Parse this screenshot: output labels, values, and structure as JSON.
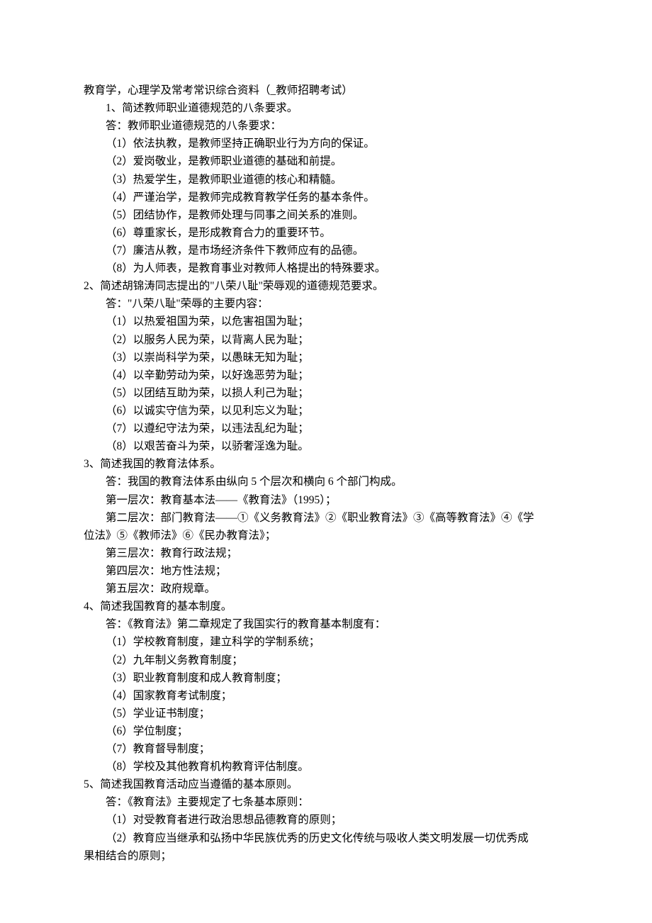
{
  "title": "教育学，心理学及常考常识综合资料（_教师招聘考试）",
  "sections": [
    {
      "q": "1、简述教师职业道德规范的八条要求。",
      "ans": "答：教师职业道德规范的八条要求：",
      "items": [
        "（1）依法执教，是教师坚持正确职业行为方向的保证。",
        "（2）爱岗敬业，是教师职业道德的基础和前提。",
        "（3）热爱学生，是教师职业道德的核心和精髓。",
        "（4）严谨治学，是教师完成教育教学任务的基本条件。",
        "（5）团结协作，是教师处理与同事之间关系的准则。",
        "（6）尊重家长，是形成教育合力的重要环节。",
        "（7）廉洁从教，是市场经济条件下教师应有的品德。",
        "（8）为人师表，是教育事业对教师人格提出的特殊要求。"
      ],
      "q_indent": true
    },
    {
      "q": "2、简述胡锦涛同志提出的\"八荣八耻\"荣辱观的道德规范要求。",
      "ans": "答：\"八荣八耻\"荣辱的主要内容：",
      "items": [
        "（1）以热爱祖国为荣，以危害祖国为耻；",
        "（2）以服务人民为荣，以背离人民为耻；",
        "（3）以崇尚科学为荣，以愚昧无知为耻；",
        "（4）以辛勤劳动为荣，以好逸恶劳为耻；",
        "（5）以团结互助为荣，以损人利己为耻；",
        "（6）以诚实守信为荣，以见利忘义为耻；",
        "（7）以遵纪守法为荣，以违法乱纪为耻；",
        "（8）以艰苦奋斗为荣，以骄奢淫逸为耻。"
      ],
      "q_indent": false
    },
    {
      "q": "3、简述我国的教育法体系。",
      "ans": "答：我国的教育法体系由纵向 5 个层次和横向 6 个部门构成。",
      "body": [
        {
          "text": "第一层次：教育基本法——《教育法》（1995）；",
          "cls": "item"
        },
        {
          "text": "第二层次：部门教育法——①《义务教育法》②《职业教育法》③《高等教育法》④《学",
          "cls": "item"
        },
        {
          "text": "位法》⑤《教师法》⑥《民办教育法》；",
          "cls": "cont"
        },
        {
          "text": "第三层次：教育行政法规；",
          "cls": "item"
        },
        {
          "text": "第四层次：地方性法规；",
          "cls": "item"
        },
        {
          "text": "第五层次：政府规章。",
          "cls": "item"
        }
      ],
      "q_indent": false
    },
    {
      "q": "4、简述我国教育的基本制度。",
      "ans": "答：《教育法》第二章规定了我国实行的教育基本制度有：",
      "items": [
        "（1）学校教育制度，建立科学的学制系统；",
        "（2）九年制义务教育制度；",
        "（3）职业教育制度和成人教育制度；",
        "（4）国家教育考试制度；",
        "（5）学业证书制度；",
        "（6）学位制度；",
        "（7）教育督导制度；",
        "（8）学校及其他教育机构教育评估制度。"
      ],
      "q_indent": false
    },
    {
      "q": "5、简述我国教育活动应当遵循的基本原则。",
      "ans": "答：《教育法》主要规定了七条基本原则：",
      "body": [
        {
          "text": "（1）对受教育者进行政治思想品德教育的原则；",
          "cls": "item"
        },
        {
          "text": "（2）教育应当继承和弘扬中华民族优秀的历史文化传统与吸收人类文明发展一切优秀成",
          "cls": "item"
        },
        {
          "text": "果相结合的原则；",
          "cls": "cont"
        }
      ],
      "q_indent": false
    }
  ]
}
